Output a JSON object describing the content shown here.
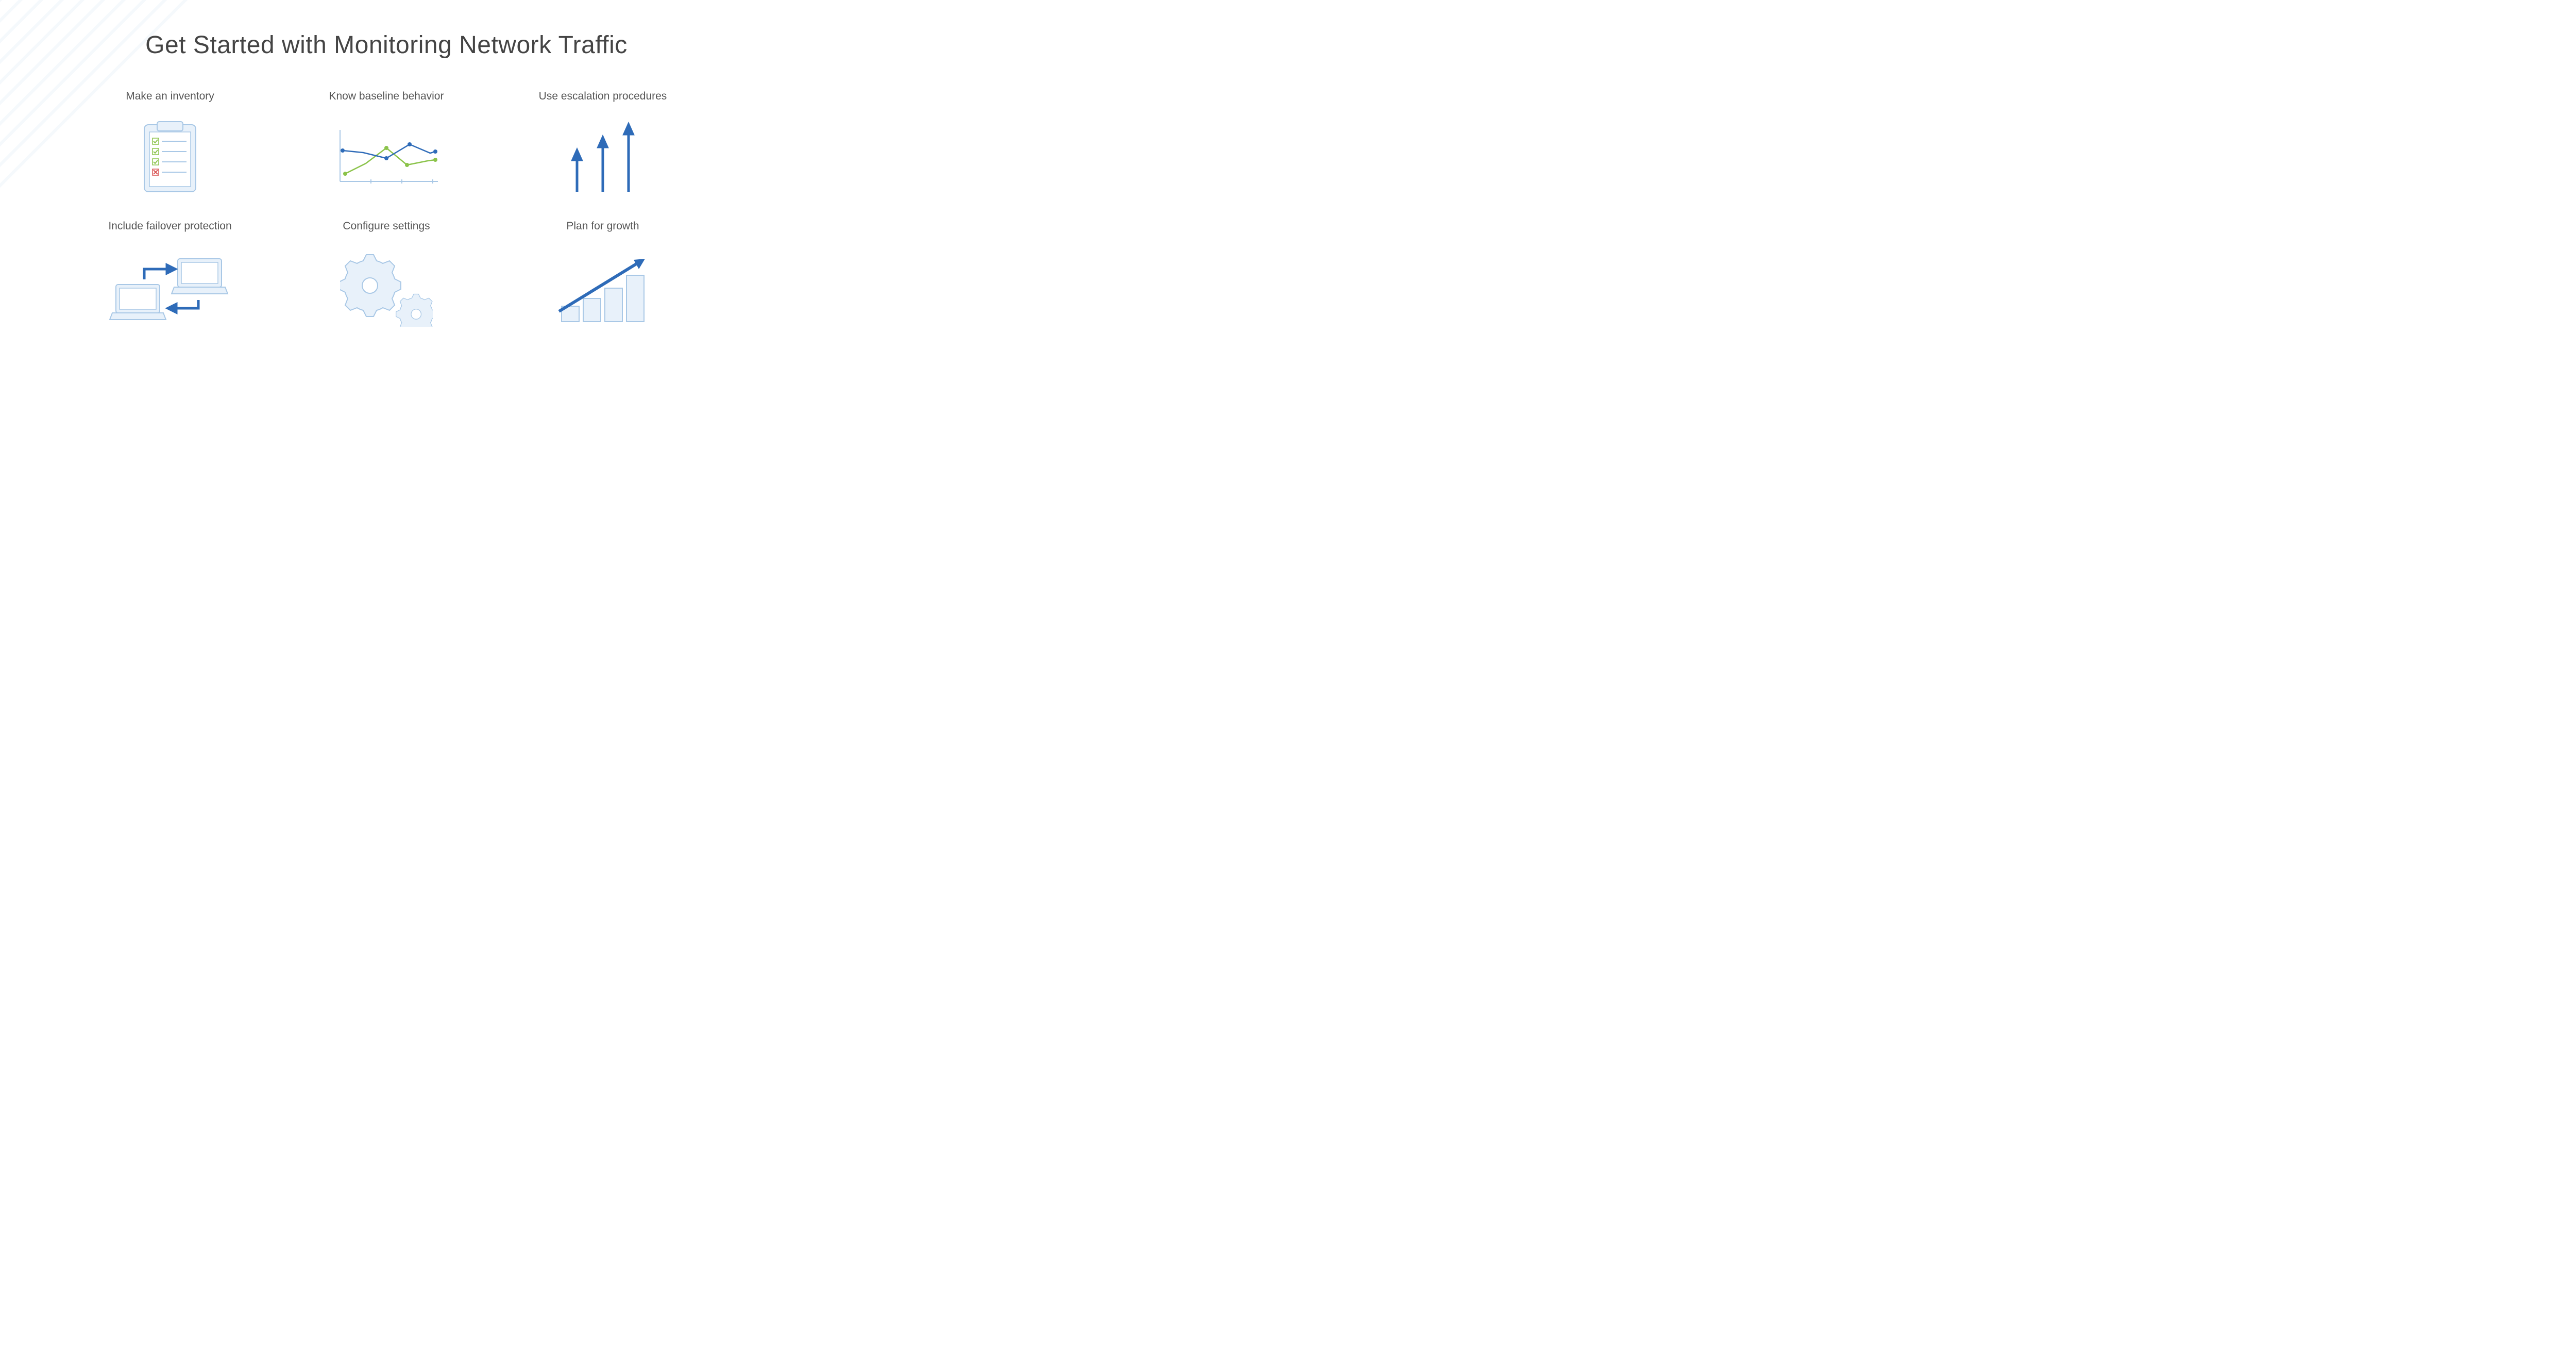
{
  "title": "Get Started with Monitoring Network Traffic",
  "cells": [
    {
      "label": "Make an inventory",
      "icon": "clipboard-checklist-icon"
    },
    {
      "label": "Know baseline behavior",
      "icon": "line-chart-icon"
    },
    {
      "label": "Use escalation procedures",
      "icon": "upward-arrows-icon"
    },
    {
      "label": "Include failover protection",
      "icon": "failover-laptops-icon"
    },
    {
      "label": "Configure settings",
      "icon": "gears-icon"
    },
    {
      "label": "Plan for growth",
      "icon": "growth-chart-icon"
    }
  ],
  "colors": {
    "text_heading": "#444444",
    "text_label": "#555555",
    "accent_blue": "#2e6bb8",
    "light_blue": "#e8f1fa",
    "outline_blue": "#a9c8e6",
    "green": "#8bc34a",
    "red": "#d95454"
  }
}
